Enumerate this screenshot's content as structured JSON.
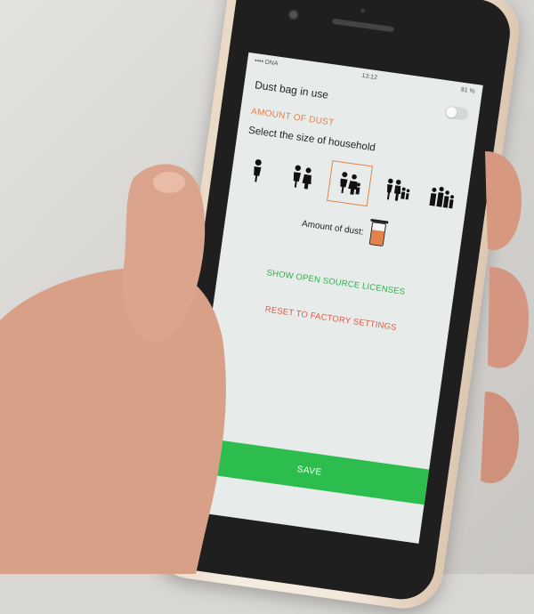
{
  "status_bar": {
    "carrier": "•••• DNA",
    "time": "13:12",
    "battery": "81 %"
  },
  "settings": {
    "title": "Dust bag in use",
    "amount_section": "AMOUNT OF DUST",
    "household_prompt": "Select the size of household",
    "household_options": [
      "1 person",
      "2 persons",
      "3 persons",
      "4 persons",
      "5+ persons"
    ],
    "selected_household_index": 2,
    "amount_label": "Amount of dust:",
    "dust_fill_fraction": 0.65,
    "licenses_link": "SHOW OPEN SOURCE LICENSES",
    "reset_link": "RESET TO FACTORY SETTINGS",
    "save_label": "SAVE"
  },
  "colors": {
    "accent_orange": "#e4824a",
    "link_green": "#2ab24c",
    "reset_red": "#e05a44",
    "save_green": "#2dbd4e"
  }
}
